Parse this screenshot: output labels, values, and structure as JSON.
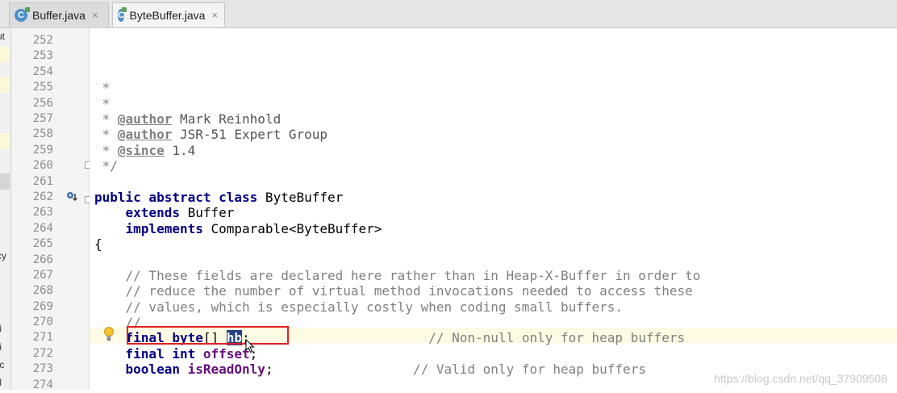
{
  "tabs": [
    {
      "label": "Buffer.java",
      "close": "×"
    },
    {
      "label": "ByteBuffer.java",
      "close": "×"
    }
  ],
  "left_panel_fragments": [
    "ut",
    "cy",
    "fi",
    "fi",
    "fc",
    "fl"
  ],
  "line_numbers": [
    "252",
    "253",
    "254",
    "255",
    "256",
    "257",
    "258",
    "259",
    "260",
    "261",
    "262",
    "263",
    "264",
    "265",
    "266",
    "267",
    "268",
    "269",
    "270",
    "271",
    "272",
    "273",
    "274"
  ],
  "code": {
    "l255": " *",
    "l256": " *",
    "l257_tag": "@author",
    "l257_val": " Mark Reinhold",
    "l258_tag": "@author",
    "l258_val": " JSR-51 Expert Group",
    "l259_tag": "@since",
    "l259_val": " 1.4",
    "l260": " */",
    "l262_kw": "public abstract class",
    "l262_rest": " ByteBuffer",
    "l263_kw": "extends",
    "l263_rest": " Buffer",
    "l264_kw": "implements",
    "l264_rest": " Comparable<ByteBuffer>",
    "l265": "{",
    "l267": "// These fields are declared here rather than in Heap-X-Buffer in order to",
    "l268": "// reduce the number of virtual method invocations needed to access these",
    "l269": "// values, which is especially costly when coding small buffers.",
    "l270": "//",
    "l271_kw": "final byte",
    "l271_br": "[] ",
    "l271_field": "hb",
    "l271_semi": ";",
    "l271_cm": "// Non-null only for heap buffers",
    "l272_kw": "final int",
    "l272_field": "offset",
    "l272_semi": ";",
    "l273_kw": "boolean",
    "l273_field": "isReadOnly",
    "l273_semi": ";",
    "l273_cm": "// Valid only for heap buffers"
  },
  "watermark": "https://blog.csdn.net/qq_37909508",
  "colors": {
    "keyword": "#000080",
    "comment": "#808080",
    "field": "#660e7a",
    "highlight_box": "#e02020"
  }
}
